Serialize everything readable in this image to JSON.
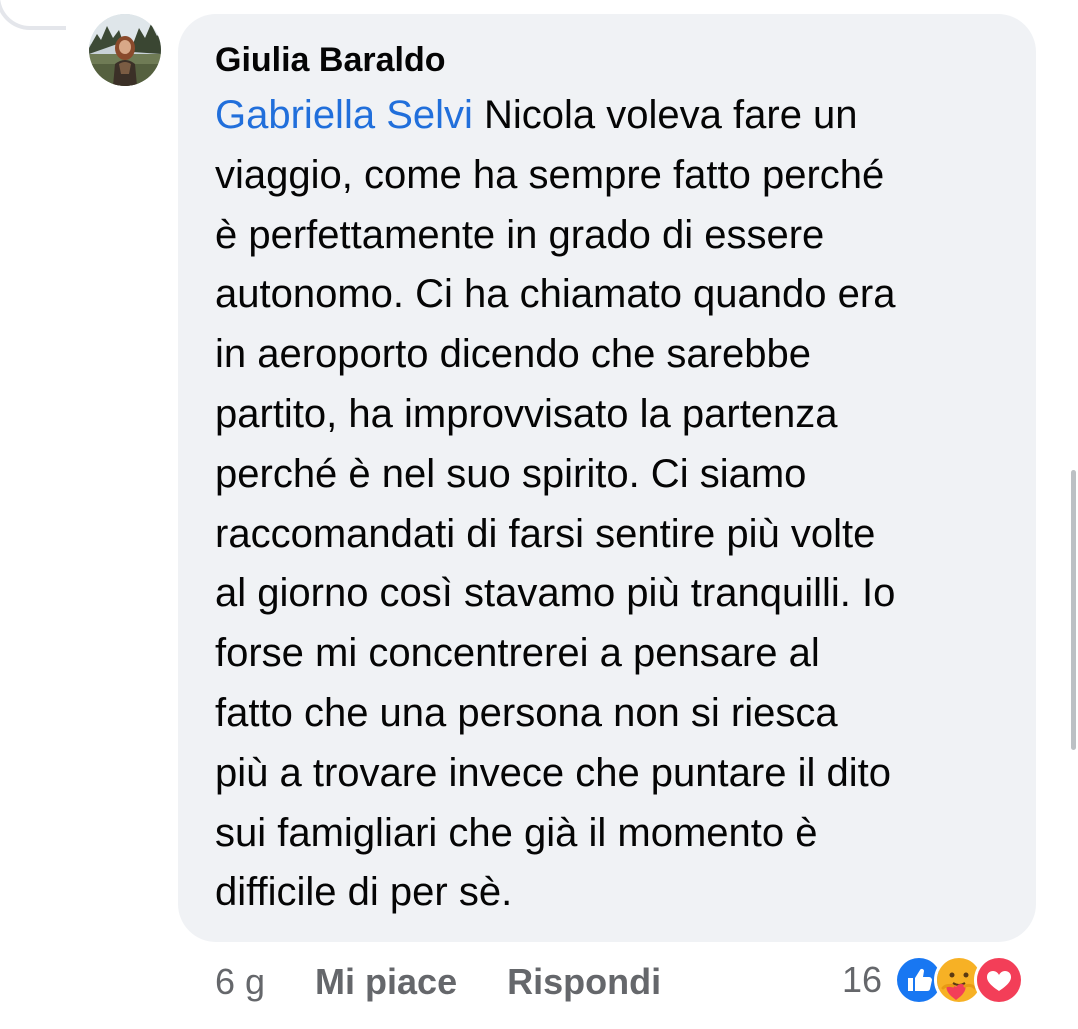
{
  "comment": {
    "author": "Giulia Baraldo",
    "mention": "Gabriella Selvi",
    "lines": [
      " Nicola voleva fare un",
      "viaggio, come ha sempre fatto perché",
      "è perfettamente in grado di essere",
      "autonomo. Ci ha chiamato quando era",
      "in aeroporto dicendo che sarebbe",
      "partito, ha improvvisato la partenza",
      "perché è nel suo spirito. Ci siamo",
      "raccomandati di farsi sentire più volte",
      "al giorno così stavamo più tranquilli. Io",
      "forse mi concentrerei a pensare al",
      "fatto che una persona non si riesca",
      "più a trovare invece che puntare il dito",
      "sui famigliari che già il momento è",
      "difficile di per sè."
    ]
  },
  "actions": {
    "timestamp": "6 g",
    "like_label": "Mi piace",
    "reply_label": "Rispondi"
  },
  "reactions": {
    "count": "16",
    "icons": [
      "like-icon",
      "care-icon",
      "love-icon"
    ]
  },
  "colors": {
    "bubble": "#f0f2f5",
    "mention": "#216fdb",
    "secondary_text": "#65676b",
    "like_blue": "#1877f2",
    "love_red": "#f33e58",
    "care_yellow": "#f7b125"
  }
}
